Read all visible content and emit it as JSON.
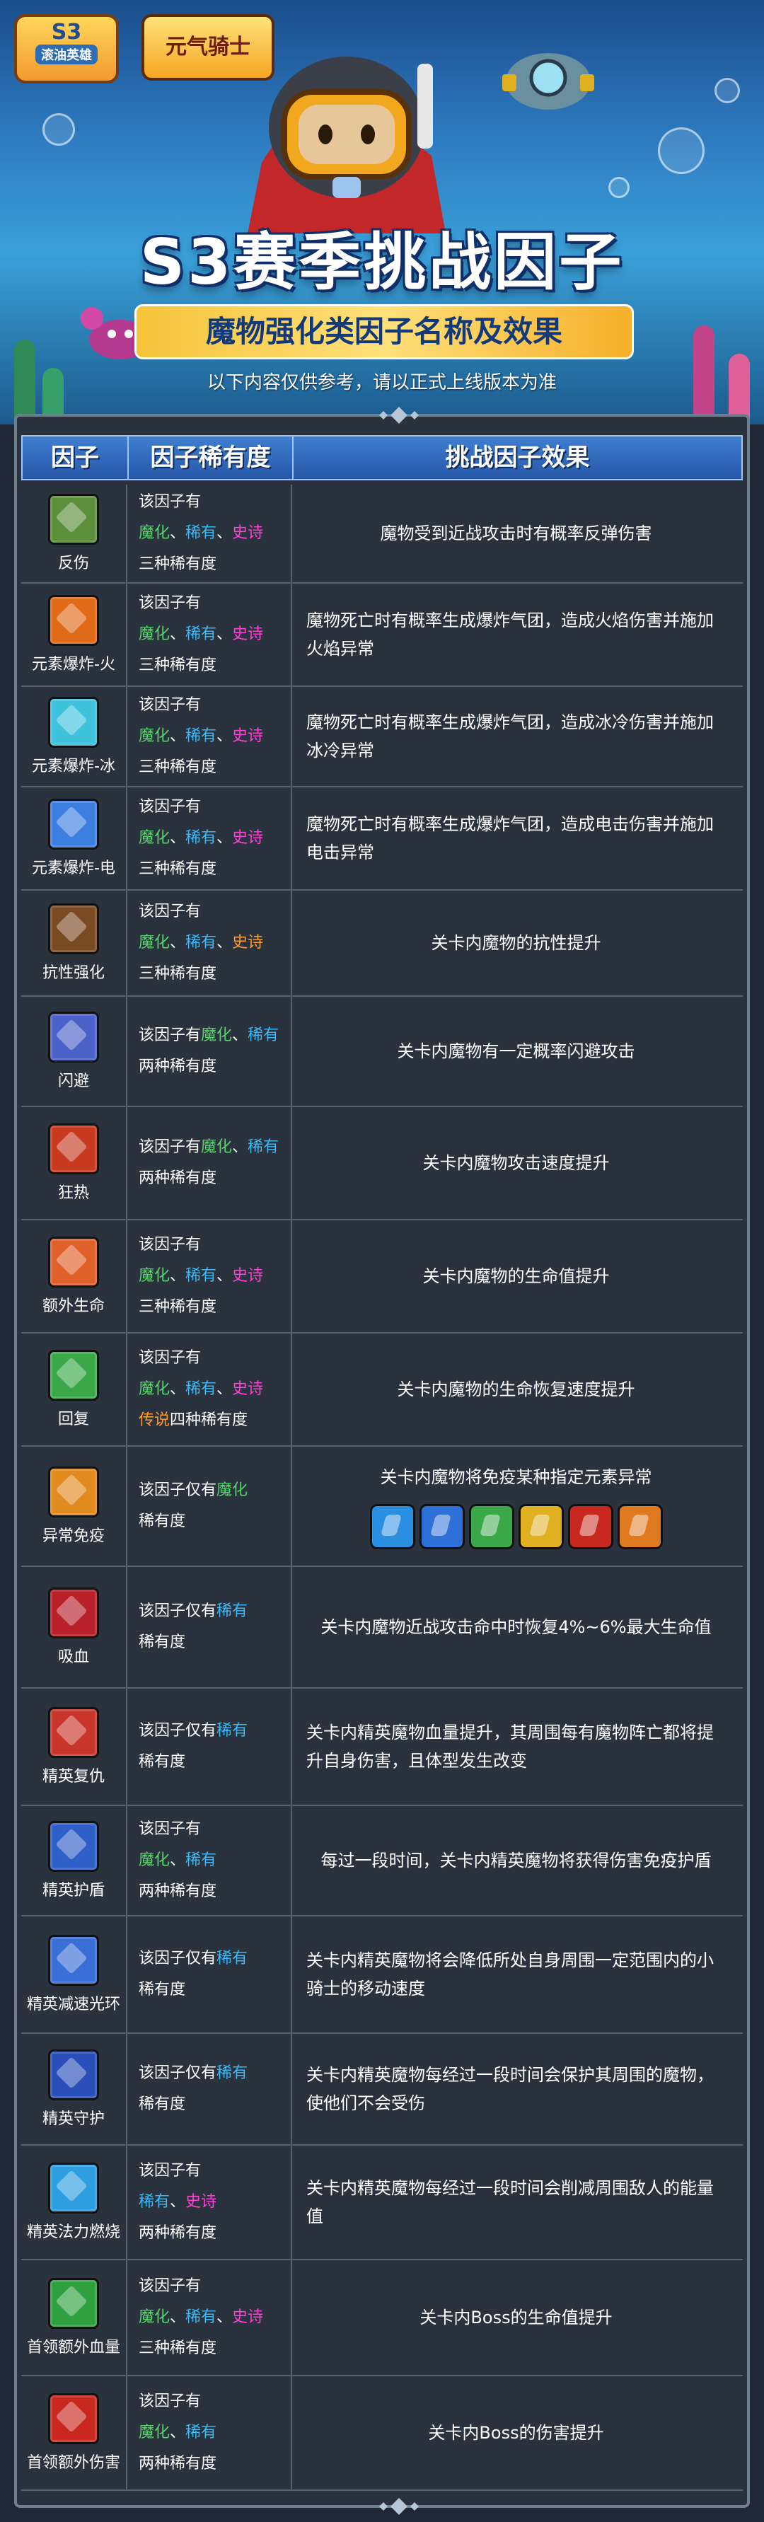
{
  "banner": {
    "badge_top": "S3",
    "badge_bottom": "滚油英雄",
    "logo_text": "元气骑士",
    "title": "S3赛季挑战因子",
    "subtitle": "魔物强化类因子名称及效果",
    "notice": "以下内容仅供参考，请以正式上线版本为准"
  },
  "table": {
    "headers": [
      "因子",
      "因子稀有度",
      "挑战因子效果"
    ],
    "rows": [
      {
        "name": "反伤",
        "icon": "reflect-icon",
        "color": "#5b8f3a",
        "lines": [
          [
            "该因子有"
          ],
          [
            {
              "t": "魔化",
              "c": "g"
            },
            "、",
            {
              "t": "稀有",
              "c": "b"
            },
            "、",
            {
              "t": "史诗",
              "c": "m"
            }
          ],
          [
            "三种稀有度"
          ]
        ],
        "effect": "魔物受到近战攻击时有概率反弹伤害",
        "h": 140
      },
      {
        "name": "元素爆炸-火",
        "icon": "fire-explosion-icon",
        "color": "#e06a18",
        "lines": [
          [
            "该因子有"
          ],
          [
            {
              "t": "魔化",
              "c": "g"
            },
            "、",
            {
              "t": "稀有",
              "c": "b"
            },
            "、",
            {
              "t": "史诗",
              "c": "m"
            }
          ],
          [
            "三种稀有度"
          ]
        ],
        "effect": "魔物死亡时有概率生成爆炸气团，造成火焰伤害并施加火焰异常",
        "left": true,
        "h": 146
      },
      {
        "name": "元素爆炸-冰",
        "icon": "ice-explosion-icon",
        "color": "#3fc2dc",
        "lines": [
          [
            "该因子有"
          ],
          [
            {
              "t": "魔化",
              "c": "g"
            },
            "、",
            {
              "t": "稀有",
              "c": "b"
            },
            "、",
            {
              "t": "史诗",
              "c": "m"
            }
          ],
          [
            "三种稀有度"
          ]
        ],
        "effect": "魔物死亡时有概率生成爆炸气团，造成冰冷伤害并施加冰冷异常",
        "left": true,
        "h": 142
      },
      {
        "name": "元素爆炸-电",
        "icon": "electric-explosion-icon",
        "color": "#3d7fe0",
        "lines": [
          [
            "该因子有"
          ],
          [
            {
              "t": "魔化",
              "c": "g"
            },
            "、",
            {
              "t": "稀有",
              "c": "b"
            },
            "、",
            {
              "t": "史诗",
              "c": "m"
            }
          ],
          [
            "三种稀有度"
          ]
        ],
        "effect": "魔物死亡时有概率生成爆炸气团，造成电击伤害并施加电击异常",
        "left": true,
        "h": 146
      },
      {
        "name": "抗性强化",
        "icon": "resistance-icon",
        "color": "#7a4a22",
        "lines": [
          [
            "该因子有"
          ],
          [
            {
              "t": "魔化",
              "c": "g"
            },
            "、",
            {
              "t": "稀有",
              "c": "b"
            },
            "、",
            {
              "t": "史诗",
              "c": "o"
            }
          ],
          [
            "三种稀有度"
          ]
        ],
        "effect": "关卡内魔物的抗性提升",
        "h": 150
      },
      {
        "name": "闪避",
        "icon": "dodge-icon",
        "color": "#4a62c8",
        "lines": [
          [
            "该因子有",
            {
              "t": "魔化",
              "c": "g"
            },
            "、",
            {
              "t": "稀有",
              "c": "b"
            }
          ],
          [
            "两种稀有度"
          ]
        ],
        "effect": "关卡内魔物有一定概率闪避攻击",
        "h": 156
      },
      {
        "name": "狂热",
        "icon": "frenzy-icon",
        "color": "#c73a1f",
        "lines": [
          [
            "该因子有",
            {
              "t": "魔化",
              "c": "g"
            },
            "、",
            {
              "t": "稀有",
              "c": "b"
            }
          ],
          [
            "两种稀有度"
          ]
        ],
        "effect": "关卡内魔物攻击速度提升",
        "h": 160
      },
      {
        "name": "额外生命",
        "icon": "extra-life-icon",
        "color": "#e0602a",
        "lines": [
          [
            "该因子有"
          ],
          [
            {
              "t": "魔化",
              "c": "g"
            },
            "、",
            {
              "t": "稀有",
              "c": "b"
            },
            "、",
            {
              "t": "史诗",
              "c": "m"
            }
          ],
          [
            "三种稀有度"
          ]
        ],
        "effect": "关卡内魔物的生命值提升",
        "h": 160
      },
      {
        "name": "回复",
        "icon": "regen-icon",
        "color": "#3aa848",
        "lines": [
          [
            "该因子有"
          ],
          [
            {
              "t": "魔化",
              "c": "g"
            },
            "、",
            {
              "t": "稀有",
              "c": "b"
            },
            "、",
            {
              "t": "史诗",
              "c": "m"
            }
          ],
          [
            {
              "t": "传说",
              "c": "o"
            },
            "四种稀有度"
          ]
        ],
        "effect": "关卡内魔物的生命恢复速度提升",
        "h": 160
      },
      {
        "name": "异常免疫",
        "icon": "status-immune-icon",
        "color": "#e08a20",
        "lines": [
          [
            "该因子仅有",
            {
              "t": "魔化",
              "c": "g"
            }
          ],
          [
            "稀有度"
          ]
        ],
        "effect": "关卡内魔物将免疫某种指定元素异常",
        "icons": true,
        "h": 170
      },
      {
        "name": "吸血",
        "icon": "lifesteal-icon",
        "color": "#b8202a",
        "lines": [
          [
            "该因子仅有",
            {
              "t": "稀有",
              "c": "b"
            }
          ],
          [
            "稀有度"
          ]
        ],
        "effect": "关卡内魔物近战攻击命中时恢复4%~6%最大生命值",
        "h": 172
      },
      {
        "name": "精英复仇",
        "icon": "elite-revenge-icon",
        "color": "#c8352a",
        "lines": [
          [
            "该因子仅有",
            {
              "t": "稀有",
              "c": "b"
            }
          ],
          [
            "稀有度"
          ]
        ],
        "effect": "关卡内精英魔物血量提升，其周围每有魔物阵亡都将提升自身伤害，且体型发生改变",
        "left": true,
        "h": 166
      },
      {
        "name": "精英护盾",
        "icon": "elite-shield-icon",
        "color": "#2f5fc8",
        "lines": [
          [
            "该因子有"
          ],
          [
            {
              "t": "魔化",
              "c": "g"
            },
            "、",
            {
              "t": "稀有",
              "c": "b"
            }
          ],
          [
            "两种稀有度"
          ]
        ],
        "effect": "每过一段时间，关卡内精英魔物将获得伤害免疫护盾",
        "h": 156
      },
      {
        "name": "精英减速光环",
        "icon": "elite-slow-aura-icon",
        "color": "#3a6fd8",
        "lines": [
          [
            "该因子仅有",
            {
              "t": "稀有",
              "c": "b"
            }
          ],
          [
            "稀有度"
          ]
        ],
        "effect": "关卡内精英魔物将会降低所处自身周围一定范围内的小骑士的移动速度",
        "left": true,
        "h": 166
      },
      {
        "name": "精英守护",
        "icon": "elite-guard-icon",
        "color": "#2a4fb8",
        "lines": [
          [
            "该因子仅有",
            {
              "t": "稀有",
              "c": "b"
            }
          ],
          [
            "稀有度"
          ]
        ],
        "effect": "关卡内精英魔物每经过一段时间会保护其周围的魔物，使他们不会受伤",
        "left": true,
        "h": 158
      },
      {
        "name": "精英法力燃烧",
        "icon": "elite-mana-burn-icon",
        "color": "#2f9ee0",
        "lines": [
          [
            "该因子有"
          ],
          [
            {
              "t": "稀有",
              "c": "b"
            },
            "、",
            {
              "t": "史诗",
              "c": "m"
            }
          ],
          [
            "两种稀有度"
          ]
        ],
        "effect": "关卡内精英魔物每经过一段时间会削减周围敌人的能量值",
        "left": true,
        "h": 162
      },
      {
        "name": "首领额外血量",
        "icon": "boss-extra-hp-icon",
        "color": "#2fa040",
        "lines": [
          [
            "该因子有"
          ],
          [
            {
              "t": "魔化",
              "c": "g"
            },
            "、",
            {
              "t": "稀有",
              "c": "b"
            },
            "、",
            {
              "t": "史诗",
              "c": "m"
            }
          ],
          [
            "三种稀有度"
          ]
        ],
        "effect": "关卡内Boss的生命值提升",
        "h": 164
      },
      {
        "name": "首领额外伤害",
        "icon": "boss-extra-damage-icon",
        "color": "#c8281e",
        "lines": [
          [
            "该因子有"
          ],
          [
            {
              "t": "魔化",
              "c": "g"
            },
            "、",
            {
              "t": "稀有",
              "c": "b"
            }
          ],
          [
            "两种稀有度"
          ]
        ],
        "effect": "关卡内Boss的伤害提升",
        "h": 162
      }
    ],
    "immune_icons": [
      {
        "name": "fire-immune-icon",
        "color": "#2a8fe0"
      },
      {
        "name": "ice-immune-icon",
        "color": "#2f6fd8"
      },
      {
        "name": "poison-immune-icon",
        "color": "#3aa848"
      },
      {
        "name": "electric-immune-icon",
        "color": "#e0b020"
      },
      {
        "name": "bleed-immune-icon",
        "color": "#c8281e"
      },
      {
        "name": "burn-immune-icon",
        "color": "#e07a20"
      }
    ]
  }
}
